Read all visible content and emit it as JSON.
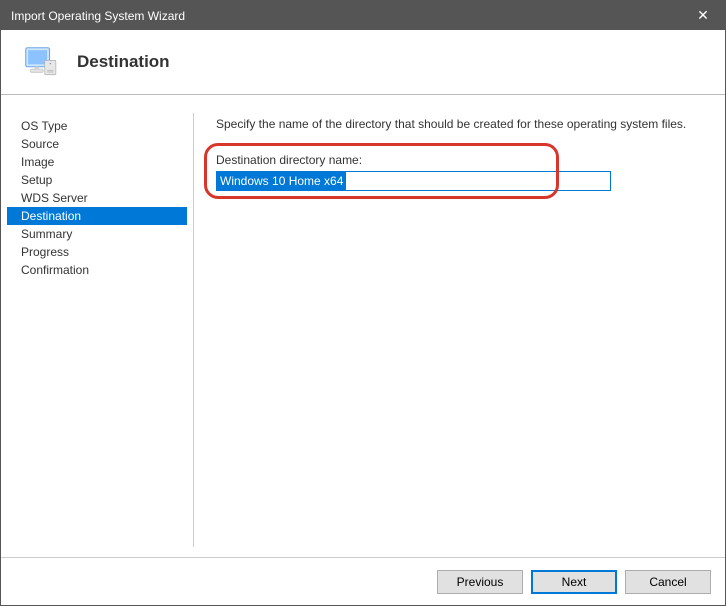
{
  "window": {
    "title": "Import Operating System Wizard"
  },
  "header": {
    "heading": "Destination"
  },
  "sidebar": {
    "items": [
      {
        "label": "OS Type",
        "selected": false
      },
      {
        "label": "Source",
        "selected": false
      },
      {
        "label": "Image",
        "selected": false
      },
      {
        "label": "Setup",
        "selected": false
      },
      {
        "label": "WDS Server",
        "selected": false
      },
      {
        "label": "Destination",
        "selected": true
      },
      {
        "label": "Summary",
        "selected": false
      },
      {
        "label": "Progress",
        "selected": false
      },
      {
        "label": "Confirmation",
        "selected": false
      }
    ]
  },
  "content": {
    "instruction": "Specify the name of the directory that should be created for these operating system files.",
    "field_label": "Destination directory name:",
    "field_value": "Windows 10 Home x64"
  },
  "footer": {
    "previous": "Previous",
    "next": "Next",
    "cancel": "Cancel"
  },
  "colors": {
    "accent": "#0078d7",
    "titlebar": "#555555",
    "highlight": "#d9362b"
  }
}
